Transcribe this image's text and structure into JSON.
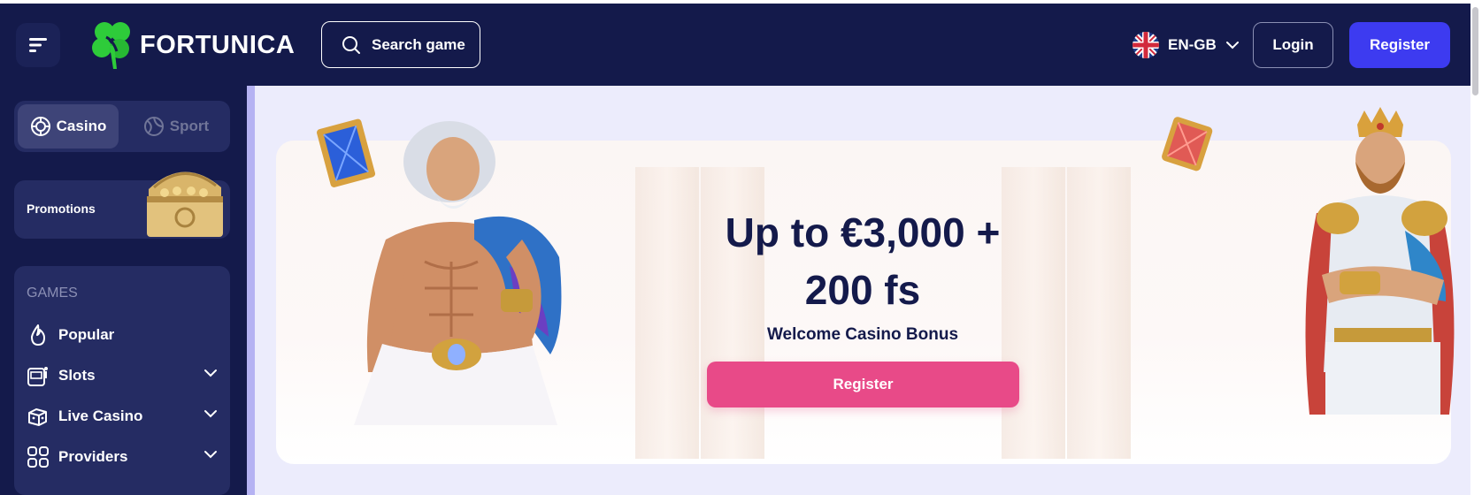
{
  "header": {
    "logo_text": "FORTUNICA",
    "search_label": "Search game",
    "language": "EN-GB",
    "login_label": "Login",
    "register_label": "Register"
  },
  "sidebar": {
    "toggle": {
      "casino": "Casino",
      "sport": "Sport",
      "active": "Casino"
    },
    "promotions_label": "Promotions",
    "games_title": "GAMES",
    "items": [
      {
        "label": "Popular",
        "icon": "flame-icon",
        "expandable": false
      },
      {
        "label": "Slots",
        "icon": "slot-machine-icon",
        "expandable": true
      },
      {
        "label": "Live Casino",
        "icon": "dice-icon",
        "expandable": true
      },
      {
        "label": "Providers",
        "icon": "grid-icon",
        "expandable": true
      }
    ]
  },
  "banner": {
    "headline_line1": "Up to €3,000 +",
    "headline_line2": "200 fs",
    "subtitle": "Welcome Casino Bonus",
    "cta_label": "Register"
  },
  "colors": {
    "header_bg": "#141a4b",
    "accent": "#3d3bf0",
    "cta": "#e84a88",
    "panel": "#252c63",
    "main_bg": "#ececfc",
    "logo_green": "#2ecc3a"
  }
}
